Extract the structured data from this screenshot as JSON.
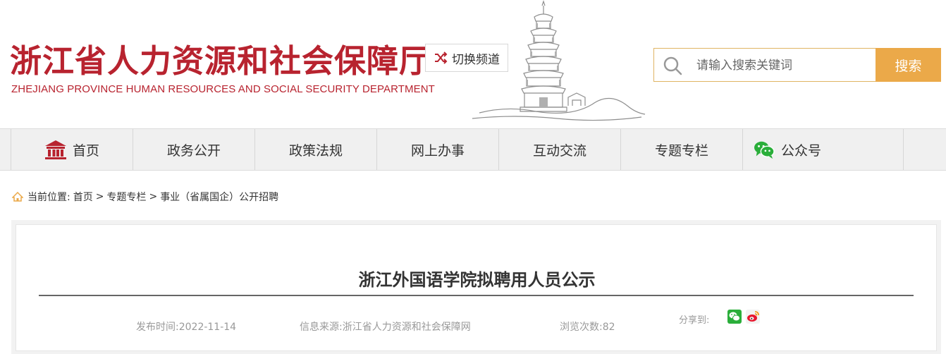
{
  "header": {
    "logo_cn": "浙江省人力资源和社会保障厅",
    "logo_en": "ZHEJIANG PROVINCE HUMAN RESOURCES AND SOCIAL SECURITY DEPARTMENT",
    "switch_channel_label": "切换频道",
    "search": {
      "placeholder": "请输入搜索关键词",
      "value": "",
      "button_label": "搜索"
    }
  },
  "nav": {
    "items": [
      {
        "label": "首页",
        "icon": "temple-icon"
      },
      {
        "label": "政务公开"
      },
      {
        "label": "政策法规"
      },
      {
        "label": "网上办事"
      },
      {
        "label": "互动交流"
      },
      {
        "label": "专题专栏"
      },
      {
        "label": "公众号",
        "icon": "wechat-icon"
      }
    ]
  },
  "breadcrumb": {
    "prefix": "当前位置:",
    "items": [
      "首页",
      "专题专栏",
      "事业（省属国企）公开招聘"
    ],
    "separator": ">"
  },
  "article": {
    "title": "浙江外国语学院拟聘用人员公示",
    "publish_time": "发布时间:2022-11-14",
    "source": "信息来源:浙江省人力资源和社会保障网",
    "views": "浏览次数:82",
    "share_label": "分享到:",
    "share_icons": [
      "wechat-share-icon",
      "weibo-share-icon"
    ]
  },
  "colors": {
    "brand_red": "#b8232f",
    "search_button": "#eba949",
    "search_border": "#e0b463",
    "nav_background": "#f0f0f0",
    "wechat_green": "#2aae3a",
    "weibo_red": "#e6162d"
  }
}
